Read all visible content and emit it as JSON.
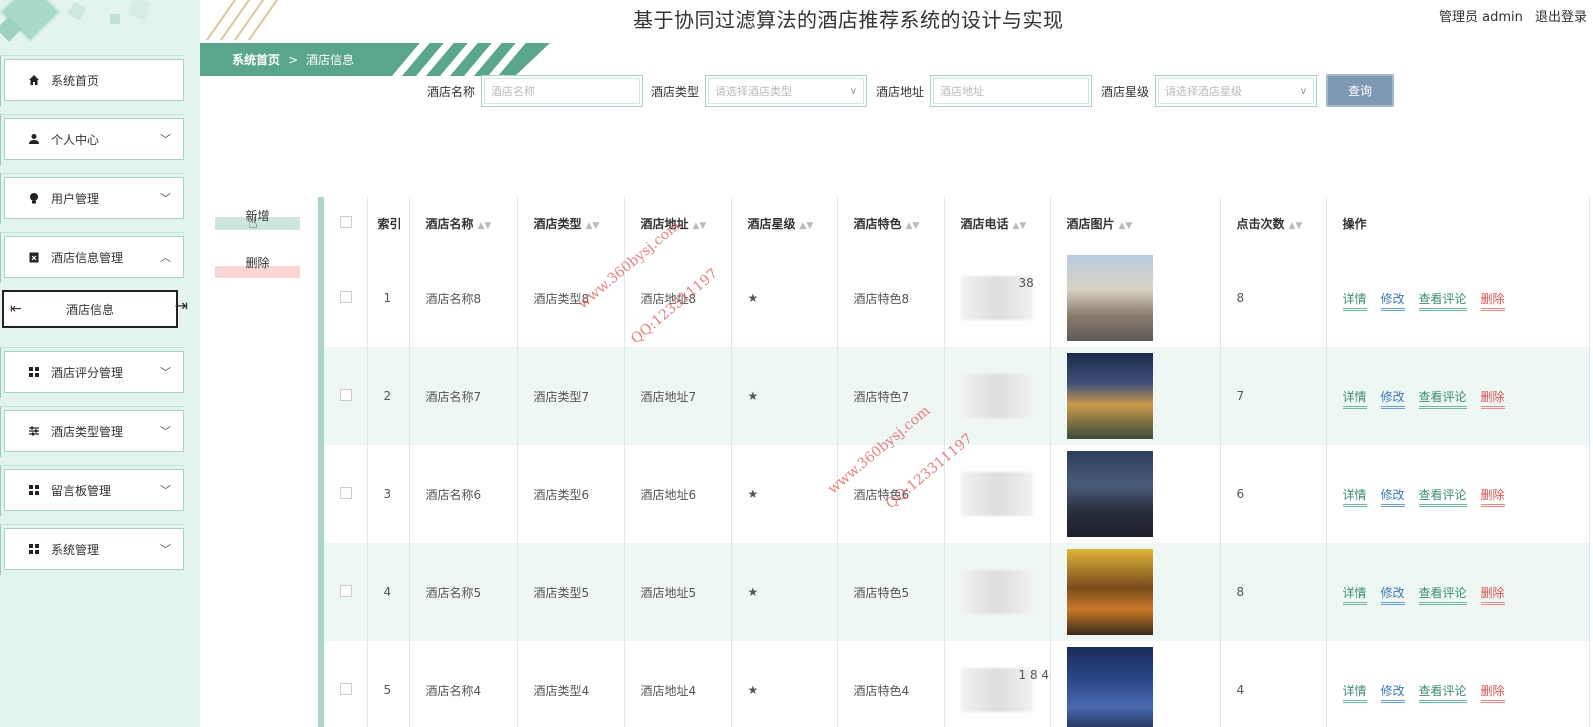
{
  "header": {
    "title": "基于协同过滤算法的酒店推荐系统的设计与实现",
    "user_label": "管理员 admin",
    "logout": "退出登录"
  },
  "breadcrumb": {
    "home": "系统首页",
    "sep": ">",
    "current": "酒店信息"
  },
  "sidebar": {
    "items": [
      {
        "label": "系统首页",
        "icon": "home-icon"
      },
      {
        "label": "个人中心",
        "icon": "user-icon"
      },
      {
        "label": "用户管理",
        "icon": "lightbulb-icon"
      },
      {
        "label": "酒店信息管理",
        "icon": "clipboard-icon"
      },
      {
        "label": "酒店评分管理",
        "icon": "grid-icon"
      },
      {
        "label": "酒店类型管理",
        "icon": "sliders-icon"
      },
      {
        "label": "留言板管理",
        "icon": "grid-icon"
      },
      {
        "label": "系统管理",
        "icon": "grid-icon"
      }
    ],
    "submenu_active": "酒店信息"
  },
  "search": {
    "name_label": "酒店名称",
    "name_placeholder": "酒店名称",
    "type_label": "酒店类型",
    "type_placeholder": "请选择酒店类型",
    "addr_label": "酒店地址",
    "addr_placeholder": "酒店地址",
    "star_label": "酒店星级",
    "star_placeholder": "请选择酒店星级",
    "button": "查询"
  },
  "actions": {
    "add": "新增",
    "delete": "删除"
  },
  "table": {
    "headers": {
      "index": "索引",
      "name": "酒店名称",
      "type": "酒店类型",
      "addr": "酒店地址",
      "star": "酒店星级",
      "feature": "酒店特色",
      "phone": "酒店电话",
      "image": "酒店图片",
      "clicks": "点击次数",
      "ops": "操作"
    },
    "ops": {
      "detail": "详情",
      "edit": "修改",
      "comments": "查看评论",
      "delete": "删除"
    },
    "rows": [
      {
        "index": "1",
        "name": "酒店名称8",
        "type": "酒店类型8",
        "addr": "酒店地址8",
        "star": "★",
        "feature": "酒店特色8",
        "phone_visible": "38",
        "clicks": "8"
      },
      {
        "index": "2",
        "name": "酒店名称7",
        "type": "酒店类型7",
        "addr": "酒店地址7",
        "star": "★",
        "feature": "酒店特色7",
        "phone_visible": "",
        "clicks": "7"
      },
      {
        "index": "3",
        "name": "酒店名称6",
        "type": "酒店类型6",
        "addr": "酒店地址6",
        "star": "★",
        "feature": "酒店特色6",
        "phone_visible": "",
        "clicks": "6"
      },
      {
        "index": "4",
        "name": "酒店名称5",
        "type": "酒店类型5",
        "addr": "酒店地址5",
        "star": "★",
        "feature": "酒店特色5",
        "phone_visible": "",
        "clicks": "8"
      },
      {
        "index": "5",
        "name": "酒店名称4",
        "type": "酒店类型4",
        "addr": "酒店地址4",
        "star": "★",
        "feature": "酒店特色4",
        "phone_visible": "1 8 4",
        "clicks": "4"
      }
    ]
  },
  "watermarks": [
    "www.360bysj.com",
    "QQ:123311197"
  ],
  "colors": {
    "sidebar_bg": "#e3f3ee",
    "accent": "#5aa58d",
    "query_button": "#7d98b3",
    "delete_red": "#d9534f"
  }
}
